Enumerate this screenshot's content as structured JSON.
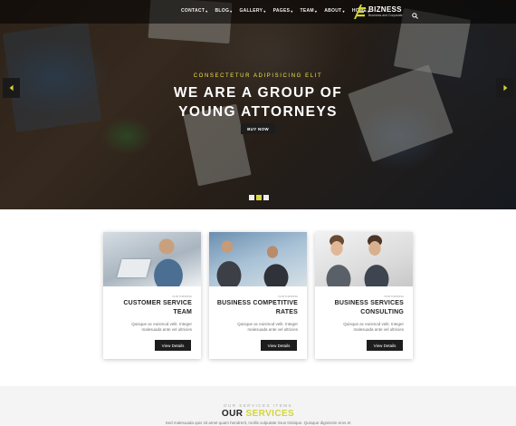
{
  "nav": {
    "items": [
      {
        "label": "CONTACT"
      },
      {
        "label": "BLOG"
      },
      {
        "label": "GALLERY"
      },
      {
        "label": "PAGES"
      },
      {
        "label": "TEAM"
      },
      {
        "label": "ABOUT"
      },
      {
        "label": "HOME"
      }
    ],
    "logo_name": "BIZNESS",
    "logo_tagline": "Business and Corporate"
  },
  "hero": {
    "subtitle": "CONSECTETUR ADIPISICING ELIT",
    "title_line1": "WE ARE A GROUP OF",
    "title_line2": "YOUNG ATTORNEYS",
    "button": "BUY NOW"
  },
  "cards": [
    {
      "tag": "OUR THINKING",
      "title_line1": "CUSTOMER SERVICE",
      "title_line2": "TEAM",
      "text_line1": "Quisque ac euismod velit. Integer",
      "text_line2": "malesuada ante vel ultricies",
      "button": "View Details"
    },
    {
      "tag": "OUR THINKING",
      "title_line1": "BUSINESS COMPETITIVE",
      "title_line2": "RATES",
      "text_line1": "Quisque ac euismod velit. Integer",
      "text_line2": "malesuada ante vel ultricies",
      "button": "View Details"
    },
    {
      "tag": "OUR THINKING",
      "title_line1": "BUSINESS SERVICES",
      "title_line2": "CONSULTING",
      "text_line1": "Quisque ac euismod velit. Integer",
      "text_line2": "malesuada ante vel ultricies",
      "button": "View Details"
    }
  ],
  "services": {
    "subtitle": "OUR SERVICES ITEMS",
    "title_main": "OUR ",
    "title_accent": "SERVICES",
    "description": "Sed malesuada quis sit amet quam hendrerit, mollis vulputate risus tristique. Quisque dignissim eros et"
  },
  "colors": {
    "accent": "#d3d43a",
    "dark": "#1d1d1d",
    "hero_subtitle": "#f4e14a"
  }
}
